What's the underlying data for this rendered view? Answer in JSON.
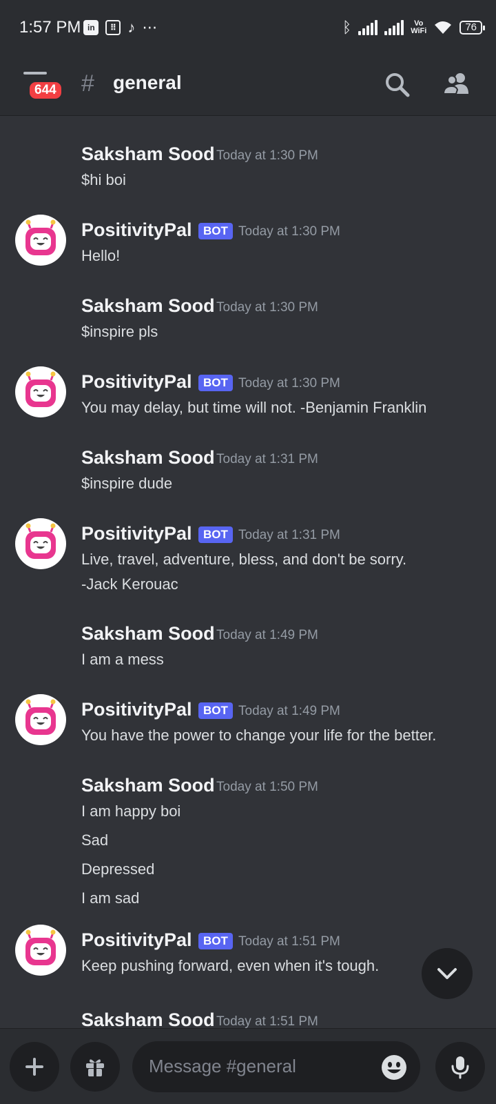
{
  "status_bar": {
    "time": "1:57 PM",
    "left_icons": [
      "linkedin-icon",
      "app-grid-icon",
      "tiktok-icon",
      "more-notifications-icon"
    ],
    "vowifi_top": "Vo",
    "vowifi_bottom": "WiFi",
    "battery": "76"
  },
  "header": {
    "unread_badge": "644",
    "hash": "#",
    "channel": "general"
  },
  "messages": [
    {
      "author": "Saksham Sood",
      "bot": false,
      "time": "Today at 1:30 PM",
      "lines": [
        "$hi boi"
      ]
    },
    {
      "author": "PositivityPal",
      "bot": true,
      "bot_label": "BOT",
      "time": "Today at 1:30 PM",
      "lines": [
        "Hello!"
      ]
    },
    {
      "author": "Saksham Sood",
      "bot": false,
      "time": "Today at 1:30 PM",
      "lines": [
        "$inspire pls"
      ]
    },
    {
      "author": "PositivityPal",
      "bot": true,
      "bot_label": "BOT",
      "time": "Today at 1:30 PM",
      "lines": [
        "You may delay, but time will not. -Benjamin Franklin"
      ]
    },
    {
      "author": "Saksham Sood",
      "bot": false,
      "time": "Today at 1:31 PM",
      "lines": [
        "$inspire dude"
      ]
    },
    {
      "author": "PositivityPal",
      "bot": true,
      "bot_label": "BOT",
      "time": "Today at 1:31 PM",
      "lines": [
        "Live, travel, adventure, bless, and don't be sorry.",
        "-Jack Kerouac"
      ]
    },
    {
      "author": "Saksham Sood",
      "bot": false,
      "time": "Today at 1:49 PM",
      "lines": [
        "I am a mess"
      ]
    },
    {
      "author": "PositivityPal",
      "bot": true,
      "bot_label": "BOT",
      "time": "Today at 1:49 PM",
      "lines": [
        "You have the power to change your life for the better."
      ]
    },
    {
      "author": "Saksham Sood",
      "bot": false,
      "time": "Today at 1:50 PM",
      "lines": [
        "I am happy boi",
        "Sad",
        "Depressed",
        "I am sad"
      ]
    },
    {
      "author": "PositivityPal",
      "bot": true,
      "bot_label": "BOT",
      "time": "Today at 1:51 PM",
      "lines": [
        "Keep pushing forward, even when it's tough."
      ]
    },
    {
      "author": "Saksham Sood",
      "bot": false,
      "time": "Today at 1:51 PM",
      "lines": []
    }
  ],
  "composer": {
    "placeholder": "Message #general",
    "buttons": [
      "plus-icon",
      "gift-icon",
      "emoji-icon",
      "microphone-icon"
    ]
  },
  "colors": {
    "background": "#313338",
    "header": "#2b2d31",
    "bot_tag": "#5865f2",
    "badge": "#f23f43",
    "avatar_pink": "#e8368f"
  }
}
